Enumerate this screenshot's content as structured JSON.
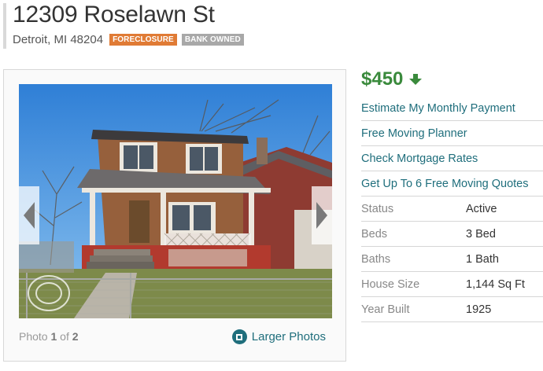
{
  "listing": {
    "title": "12309 Roselawn St",
    "address": "Detroit, MI 48204",
    "badges": [
      "FORECLOSURE",
      "BANK OWNED"
    ]
  },
  "photo": {
    "caption_prefix": "Photo",
    "current": "1",
    "of_word": "of",
    "total": "2",
    "larger_label": "Larger Photos"
  },
  "side": {
    "price": "$450",
    "trend_icon": "arrow-down-icon",
    "links": [
      "Estimate My Monthly Payment",
      "Free Moving Planner",
      "Check Mortgage Rates",
      "Get Up To 6 Free Moving Quotes"
    ],
    "facts": [
      {
        "label": "Status",
        "value": "Active"
      },
      {
        "label": "Beds",
        "value": "3 Bed"
      },
      {
        "label": "Baths",
        "value": "1 Bath"
      },
      {
        "label": "House Size",
        "value": "1,144 Sq Ft"
      },
      {
        "label": "Year Built",
        "value": "1925"
      }
    ]
  },
  "colors": {
    "link": "#1f6e7c",
    "price": "#3a8a3c",
    "foreclosure_badge": "#e07b35",
    "bank_owned_badge": "#a8a8a8"
  }
}
